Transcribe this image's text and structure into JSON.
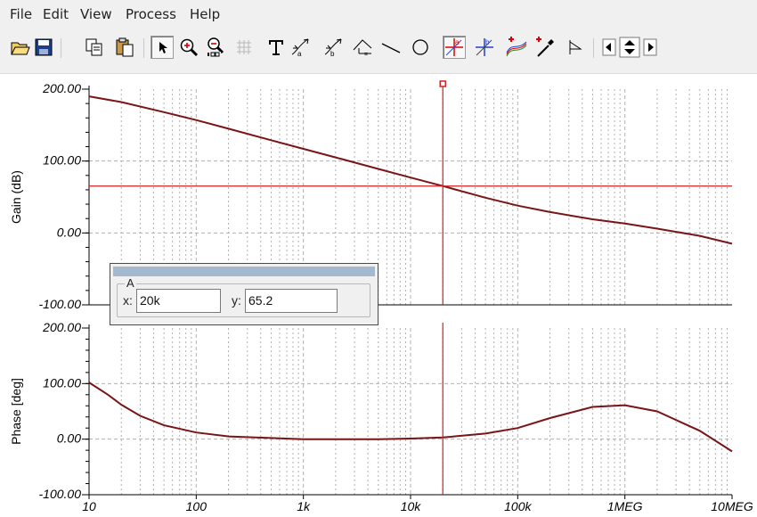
{
  "menu": [
    "File",
    "Edit",
    "View",
    "Process",
    "Help"
  ],
  "toolbar": {
    "icons": [
      "open-folder-icon",
      "save-disk-icon",
      "copy-icon",
      "paste-icon",
      "select-arrow-icon",
      "zoom-in-icon",
      "zoom-100-icon",
      "grid-icon",
      "text-tool-icon",
      "curve-label-a-icon",
      "curve-label-b-icon",
      "axis-label-icon",
      "line-tool-icon",
      "circle-tool-icon",
      "cursor-a-icon",
      "cursor-b-icon",
      "add-curve-icon",
      "probe-pen-icon",
      "marker-flag-icon",
      "arrow-left-icon",
      "arrow-updown-icon",
      "arrow-right-icon"
    ]
  },
  "cursor": {
    "group": "A",
    "x_label": "x:",
    "x_value": "20k",
    "y_label": "y:",
    "y_value": "65.2"
  },
  "chart_data": [
    {
      "type": "line",
      "ylabel": "Gain (dB)",
      "xscale": "log",
      "xlim": [
        10,
        10000000
      ],
      "ylim": [
        -100,
        200
      ],
      "yticks": [
        "200.00",
        "100.00",
        "0.00",
        "-100.00"
      ],
      "grid": true,
      "series": [
        {
          "color": "#7b1416",
          "x": [
            10,
            20,
            50,
            100,
            200,
            500,
            1000,
            2000,
            5000,
            10000,
            20000,
            50000,
            100000,
            200000,
            500000,
            1000000,
            2000000,
            5000000,
            10000000
          ],
          "y": [
            190,
            182,
            168,
            157,
            145,
            129,
            117,
            105,
            89,
            77,
            65.2,
            49,
            38,
            29,
            19,
            13,
            6,
            -4,
            -15
          ]
        }
      ],
      "cursor": {
        "x": 20000,
        "y": 65.2,
        "color": "#d22020"
      }
    },
    {
      "type": "line",
      "ylabel": "Phase [deg]",
      "xscale": "log",
      "xlim": [
        10,
        10000000
      ],
      "ylim": [
        -100,
        200
      ],
      "yticks": [
        "200.00",
        "100.00",
        "0.00",
        "-100.00"
      ],
      "xticks": [
        "10",
        "100",
        "1k",
        "10k",
        "100k",
        "1MEG",
        "10MEG"
      ],
      "grid": true,
      "series": [
        {
          "color": "#7b1416",
          "x": [
            10,
            15,
            20,
            30,
            50,
            100,
            200,
            500,
            1000,
            2000,
            5000,
            10000,
            20000,
            50000,
            100000,
            200000,
            500000,
            1000000,
            2000000,
            5000000,
            10000000
          ],
          "y": [
            102,
            80,
            62,
            42,
            25,
            12,
            5,
            2,
            0,
            0,
            0,
            1,
            3,
            10,
            20,
            38,
            58,
            61,
            50,
            15,
            -22
          ]
        }
      ],
      "cursor": {
        "x": 20000,
        "color": "#d22020"
      }
    }
  ]
}
